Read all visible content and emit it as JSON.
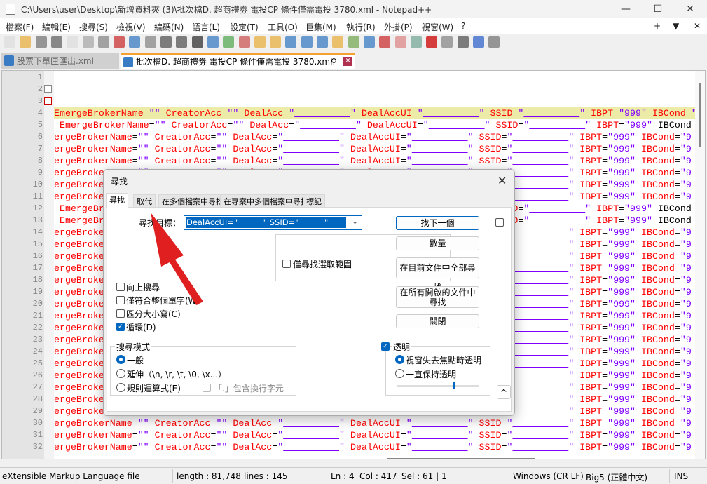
{
  "window": {
    "title": "C:\\Users\\user\\Desktop\\新增資料夾 (3)\\批次檔D. 超商禮劵 電投CP 條件僅需電投 3780.xml - Notepad++",
    "minimize": "—",
    "maximize": "☐",
    "close": "✕"
  },
  "menu": [
    "檔案(F)",
    "編輯(E)",
    "搜尋(S)",
    "檢視(V)",
    "編碼(N)",
    "語言(L)",
    "設定(T)",
    "工具(O)",
    "巨集(M)",
    "執行(R)",
    "外掛(P)",
    "視窗(W)",
    "?"
  ],
  "menu_right": [
    "+",
    "▼",
    "✕"
  ],
  "tabs": [
    {
      "label": "股票下單匣匯出.xml",
      "active": false
    },
    {
      "label": "批次檔D. 超商禮劵 電投CP 條件僅需電投 3780.xml",
      "active": true
    }
  ],
  "tab_pin": "⚲",
  "tab_close": "✕",
  "editor": {
    "line_numbers": [
      "1",
      "2",
      "3",
      "4",
      "5",
      "6",
      "7",
      "8",
      "9",
      "10",
      "11",
      "12",
      "13",
      "14",
      "15",
      "16",
      "17",
      "18",
      "19",
      "20",
      "21",
      "22",
      "23",
      "24",
      "25",
      "26",
      "27",
      "28",
      "29",
      "30",
      "31",
      "32"
    ],
    "line_a": "EmergeBrokerName=\"\" CreatorAcc=\"\" DealAcc=\"          \" DealAccUI=\"          \" SSID=\"          \" IBPT=\"999\" IBCond=\"",
    "line_b": " EmergeBrokerName=\"\" CreatorAcc=\"\" DealAcc=\"          \" DealAccUI=\"          \" SSID=\"          \" IBPT=\"999\" IBCond",
    "line_c": "ergeBrokerName=\"\" CreatorAcc=\"\" DealAcc=\"          \" DealAccUI=\"          \" SSID=\"          \" IBPT=\"999\" IBCond=\"9"
  },
  "dialog": {
    "title": "尋找",
    "close": "✕",
    "tabs": [
      "尋找",
      "取代",
      "在多個檔案中尋找",
      "在專案中多個檔案中尋找",
      "標記"
    ],
    "find_label": "尋找目標：",
    "find_value": "DealAccUI=\"          \" SSID=\"          \"",
    "buttons": {
      "find_next": "找下一個",
      "count": "數量",
      "find_all_current": "在目前文件中全部尋找",
      "find_all_open": "在所有開啟的文件中尋找",
      "close": "關閉"
    },
    "in_selection": "僅尋找選取範圍",
    "options": [
      {
        "label": "向上搜尋",
        "checked": false
      },
      {
        "label": "僅符合整個單字(W)",
        "checked": false
      },
      {
        "label": "區分大小寫(C)",
        "checked": false
      },
      {
        "label": "循環(D)",
        "checked": true
      }
    ],
    "mode_title": "搜尋模式",
    "modes": [
      {
        "label": "一般",
        "selected": true
      },
      {
        "label": "延伸（\\n, \\r, \\t, \\0, \\x...）",
        "selected": false
      },
      {
        "label": "規則運算式(E)",
        "selected": false
      }
    ],
    "dot_newline": "「.」包含換行字元",
    "transparency": {
      "label": "透明",
      "checked": true,
      "modes": [
        {
          "label": "視窗失去焦點時透明",
          "selected": true
        },
        {
          "label": "一直保持透明",
          "selected": false
        }
      ],
      "level": 0.7
    },
    "collapse": "^"
  },
  "status": {
    "type": "eXtensible Markup Language file",
    "length": "length : 81,748",
    "lines": "lines : 145",
    "ln": "Ln : 4",
    "col": "Col : 417",
    "sel": "Sel : 61 | 1",
    "eol": "Windows (CR LF)",
    "encoding": "Big5 (正體中文)",
    "mode": "INS"
  },
  "colors": {
    "accent": "#0067c0",
    "attr": "#ff0000",
    "value": "#8000ff",
    "arrow": "#e02020"
  }
}
